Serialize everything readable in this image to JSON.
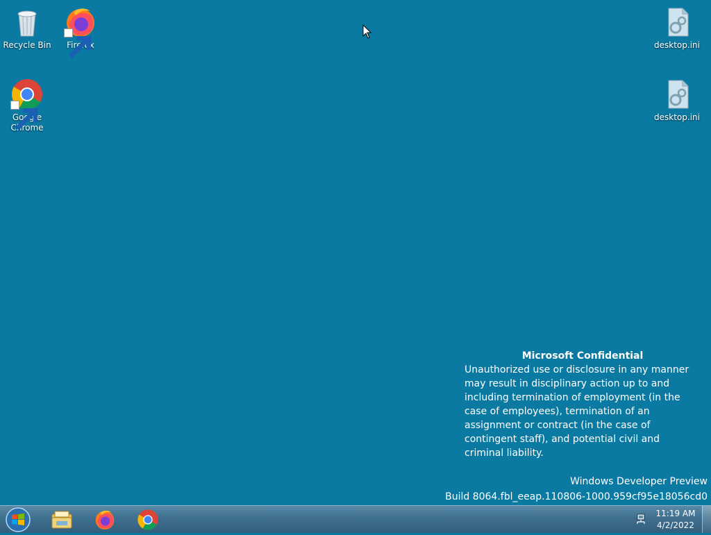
{
  "desktop": {
    "background_color": "#0a7aa2",
    "icons": [
      {
        "label": "Recycle Bin",
        "icon": "recycle-bin-icon"
      },
      {
        "label": "Firefox",
        "icon": "firefox-icon"
      },
      {
        "label": "Google Chrome",
        "icon": "chrome-icon"
      },
      {
        "label": "desktop.ini",
        "icon": "settings-file-icon"
      },
      {
        "label": "desktop.ini",
        "icon": "settings-file-icon"
      }
    ]
  },
  "watermark": {
    "title": "Microsoft Confidential",
    "body": "Unauthorized use or disclosure in any manner may result in disciplinary action up to and including termination of employment (in the case of employees), termination of an assignment or contract (in the case of contingent staff), and potential civil and criminal liability."
  },
  "build_info": {
    "edition": "Windows Developer Preview",
    "build": "Build 8064.fbl_eeap.110806-1000.959cf95e18056cd0"
  },
  "taskbar": {
    "pinned": [
      "windows-explorer-icon",
      "firefox-icon",
      "chrome-icon"
    ],
    "tray_icon": "network-icon",
    "time": "11:19 AM",
    "date": "4/2/2022"
  }
}
